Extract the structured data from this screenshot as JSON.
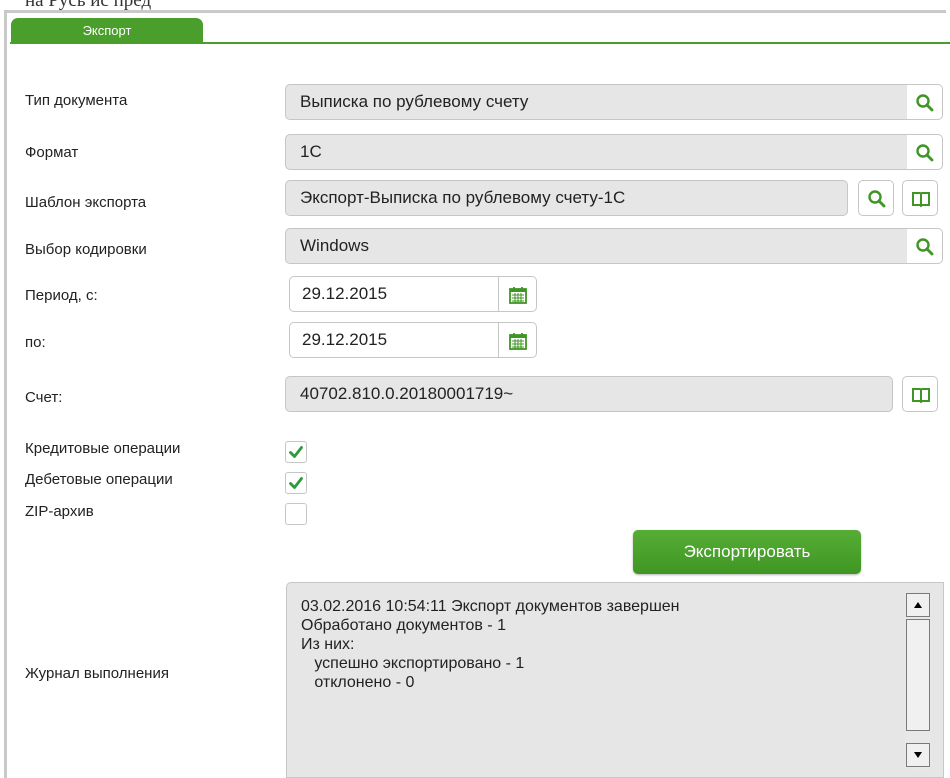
{
  "page": {
    "above_text": "на Русь ис пред"
  },
  "tabs": [
    {
      "label": "Экспорт",
      "active": true
    }
  ],
  "colors": {
    "accent": "#4a9e2b",
    "field_bg": "#e6e6e6",
    "border": "#c6c6c6"
  },
  "form": {
    "doc_type": {
      "label": "Тип документа",
      "value": "Выписка по рублевому счету"
    },
    "format": {
      "label": "Формат",
      "value": "1С"
    },
    "template": {
      "label": "Шаблон экспорта",
      "value": "Экспорт-Выписка по рублевому счету-1С"
    },
    "encoding": {
      "label": "Выбор кодировки",
      "value": "Windows"
    },
    "period_from": {
      "label": "Период, с:",
      "value": "29.12.2015"
    },
    "period_to": {
      "label": "по:",
      "value": "29.12.2015"
    },
    "account": {
      "label": "Счет:",
      "value": "40702.810.0.20180001719~"
    },
    "credit_ops": {
      "label": "Кредитовые операции",
      "checked": true
    },
    "debit_ops": {
      "label": "Дебетовые операции",
      "checked": true
    },
    "zip": {
      "label": "ZIP-архив",
      "checked": false
    },
    "export_button": "Экспортировать"
  },
  "log": {
    "label": "Журнал выполнения",
    "lines": [
      "03.02.2016 10:54:11 Экспорт документов завершен",
      "Обработано документов - 1",
      "Из них:",
      "   успешно экспортировано - 1",
      "   отклонено - 0"
    ]
  },
  "icons": [
    "search-icon",
    "book-icon",
    "calendar-icon",
    "checkmark-icon",
    "scroll-up-icon",
    "scroll-down-icon"
  ]
}
